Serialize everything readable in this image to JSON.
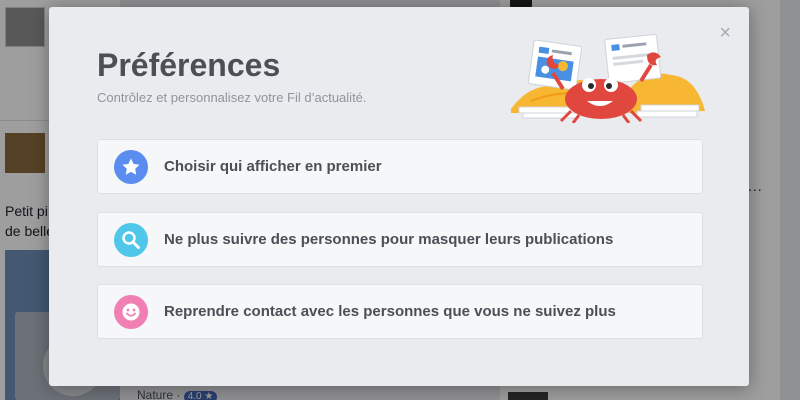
{
  "background": {
    "snippet_line1": "Petit pi",
    "snippet_line2": "de belle",
    "footer_category": "Nature",
    "footer_separator": "·",
    "footer_rating": "4.0 ★",
    "dots": "..."
  },
  "modal": {
    "title": "Préférences",
    "subtitle": "Contrôlez et personnalisez votre Fil d’actualité.",
    "close_label": "×",
    "options": [
      {
        "label": "Choisir qui afficher en premier",
        "icon": "star-icon",
        "color": "#5b8df0"
      },
      {
        "label": "Ne plus suivre des personnes pour masquer leurs publications",
        "icon": "search-icon",
        "color": "#4fc7e8"
      },
      {
        "label": "Reprendre contact avec les personnes que vous ne suivez plus",
        "icon": "smiley-icon",
        "color": "#f07fb3"
      }
    ]
  },
  "colors": {
    "modal_bg": "#e9ebee",
    "option_bg": "#f6f7f9",
    "title_text": "#4b4f56",
    "subtitle_text": "#90949c",
    "crab": "#e0483f",
    "sand": "#f7b733"
  }
}
